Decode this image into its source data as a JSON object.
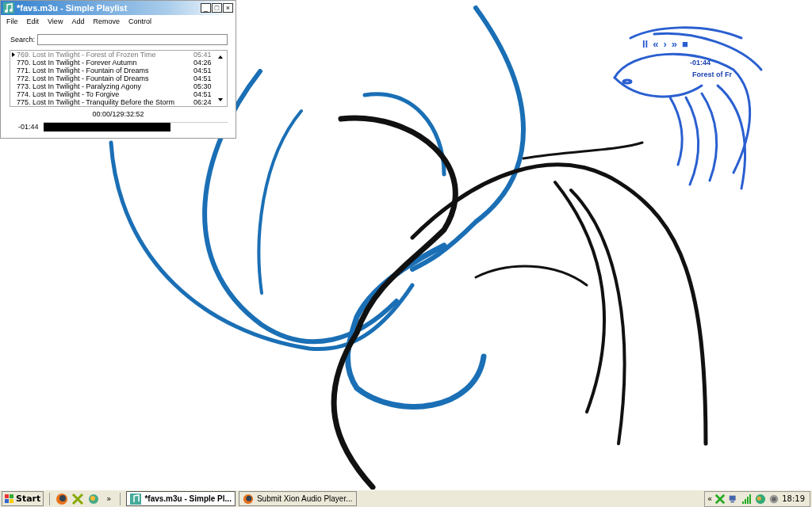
{
  "window": {
    "title": "*favs.m3u - Simple Playlist",
    "controls": [
      "_",
      "□",
      "×"
    ]
  },
  "menu": [
    "File",
    "Edit",
    "View",
    "Add",
    "Remove",
    "Control"
  ],
  "search": {
    "label": "Search:"
  },
  "playlist": [
    {
      "title": "769. Lost In Twilight - Forest of Frozen Time",
      "duration": "05:41",
      "playing": true
    },
    {
      "title": "770. Lost In Twilight - Forever Autumn",
      "duration": "04:26",
      "playing": false
    },
    {
      "title": "771. Lost In Twilight - Fountain of Dreams",
      "duration": "04:51",
      "playing": false
    },
    {
      "title": "772. Lost In Twilight - Fountain of Dreams",
      "duration": "04:51",
      "playing": false
    },
    {
      "title": "773. Lost In Twilight - Paralyzing Agony",
      "duration": "05:30",
      "playing": false
    },
    {
      "title": "774. Lost In Twilight - To Forgive",
      "duration": "04:51",
      "playing": false
    },
    {
      "title": "775. Lost In Twilight - Tranquility Before the Storm",
      "duration": "06:24",
      "playing": false
    }
  ],
  "total_time": "00:00/129:32:52",
  "seek": {
    "reading": "-01:44",
    "level": 0.69
  },
  "skin_player": {
    "controls": [
      "II",
      "«",
      "›",
      "»",
      "■"
    ],
    "time": "-01:44",
    "track": "Forest of Fr"
  },
  "taskbar": {
    "start": "Start",
    "more": "»",
    "tasks": [
      {
        "label": "*favs.m3u - Simple Pl...",
        "selected": true,
        "kind": "player"
      },
      {
        "label": "Submit Xion Audio Player...",
        "selected": false,
        "kind": "browser"
      }
    ],
    "tray_expand": "«",
    "clock": "18:19"
  }
}
